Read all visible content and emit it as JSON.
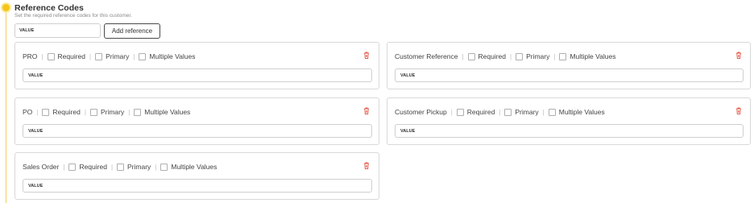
{
  "section": {
    "title": "Reference Codes",
    "subtitle": "Set the required reference codes for this customer."
  },
  "new_reference": {
    "value": "VALUE",
    "add_label": "Add reference"
  },
  "checkbox_labels": {
    "required": "Required",
    "primary": "Primary",
    "multiple": "Multiple Values"
  },
  "cards": [
    {
      "name": "PRO",
      "value": "VALUE",
      "required": false,
      "primary": false,
      "multiple": false
    },
    {
      "name": "Customer Reference",
      "value": "VALUE",
      "required": false,
      "primary": false,
      "multiple": false
    },
    {
      "name": "PO",
      "value": "VALUE",
      "required": false,
      "primary": false,
      "multiple": false
    },
    {
      "name": "Customer Pickup",
      "value": "VALUE",
      "required": false,
      "primary": false,
      "multiple": false
    },
    {
      "name": "Sales Order",
      "value": "VALUE",
      "required": false,
      "primary": false,
      "multiple": false
    }
  ],
  "colors": {
    "accent": "#f5c518",
    "delete": "#e05a4a",
    "border": "#d9d9d9"
  },
  "icons": {
    "delete": "trash-icon",
    "timeline": "timeline-dot-icon"
  }
}
